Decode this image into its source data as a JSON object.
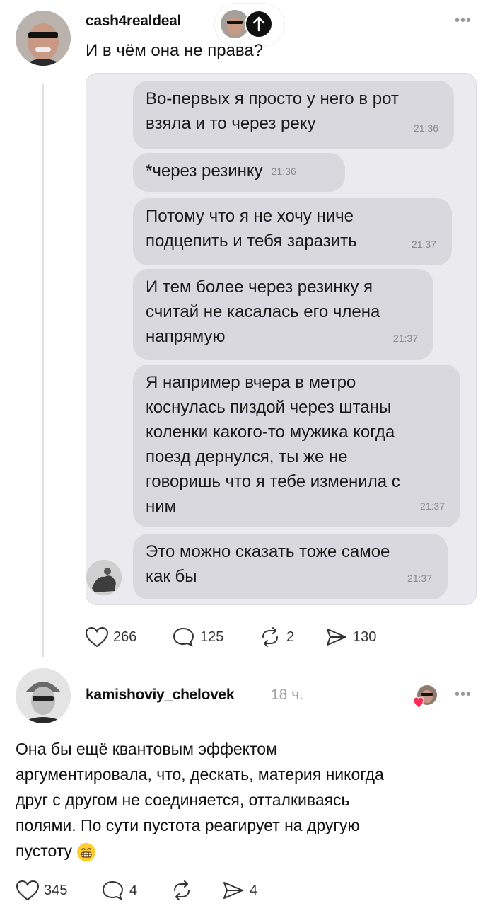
{
  "post": {
    "username": "cash4realdeal",
    "text": "И в чём она не права?",
    "more_label": "•••",
    "stats": {
      "likes": "266",
      "comments": "125",
      "reposts": "2",
      "shares": "130"
    }
  },
  "chat": {
    "messages": [
      {
        "text": "Во-первых я просто у него в рот\nвзяла и то через реку",
        "time": "21:36"
      },
      {
        "text": "*через резинку",
        "time": "21:36"
      },
      {
        "text": "Потому что я не хочу ниче\nподцепить и тебя заразить",
        "time": "21:37"
      },
      {
        "text": "И тем более через резинку я\nсчитай не касалась его члена\nнапрямую",
        "time": "21:37"
      },
      {
        "text": "Я например вчера в метро\nкоснулась пиздой через штаны\nколенки какого-то мужика когда\nпоезд дернулся, ты же не\nговоришь что я тебе изменила с\nним",
        "time": "21:37"
      },
      {
        "text": "Это можно сказать тоже самое\nкак бы",
        "time": "21:37"
      }
    ]
  },
  "reply": {
    "username": "kamishoviy_chelovek",
    "time": "18 ч.",
    "more_label": "•••",
    "text": "Она бы ещё квантовым эффектом\nаргументировала, что, дескать, материя никогда\nдруг с другом не соединяется, отталкиваясь\nполями. По сути пустота реагирует на другую\nпустоту",
    "stats": {
      "likes": "345",
      "comments": "4",
      "shares": "4"
    }
  },
  "icons": {
    "like": "heart-icon",
    "comment": "comment-bubble-icon",
    "repost": "repost-arrows-icon",
    "share": "send-icon",
    "reaction": "heart-avatar-reaction-icon",
    "emoji": "grinning-face-emoji"
  },
  "colors": {
    "chat_bg": "#ebebef",
    "bubble": "#d8d8de",
    "muted": "#a0a0a0"
  }
}
